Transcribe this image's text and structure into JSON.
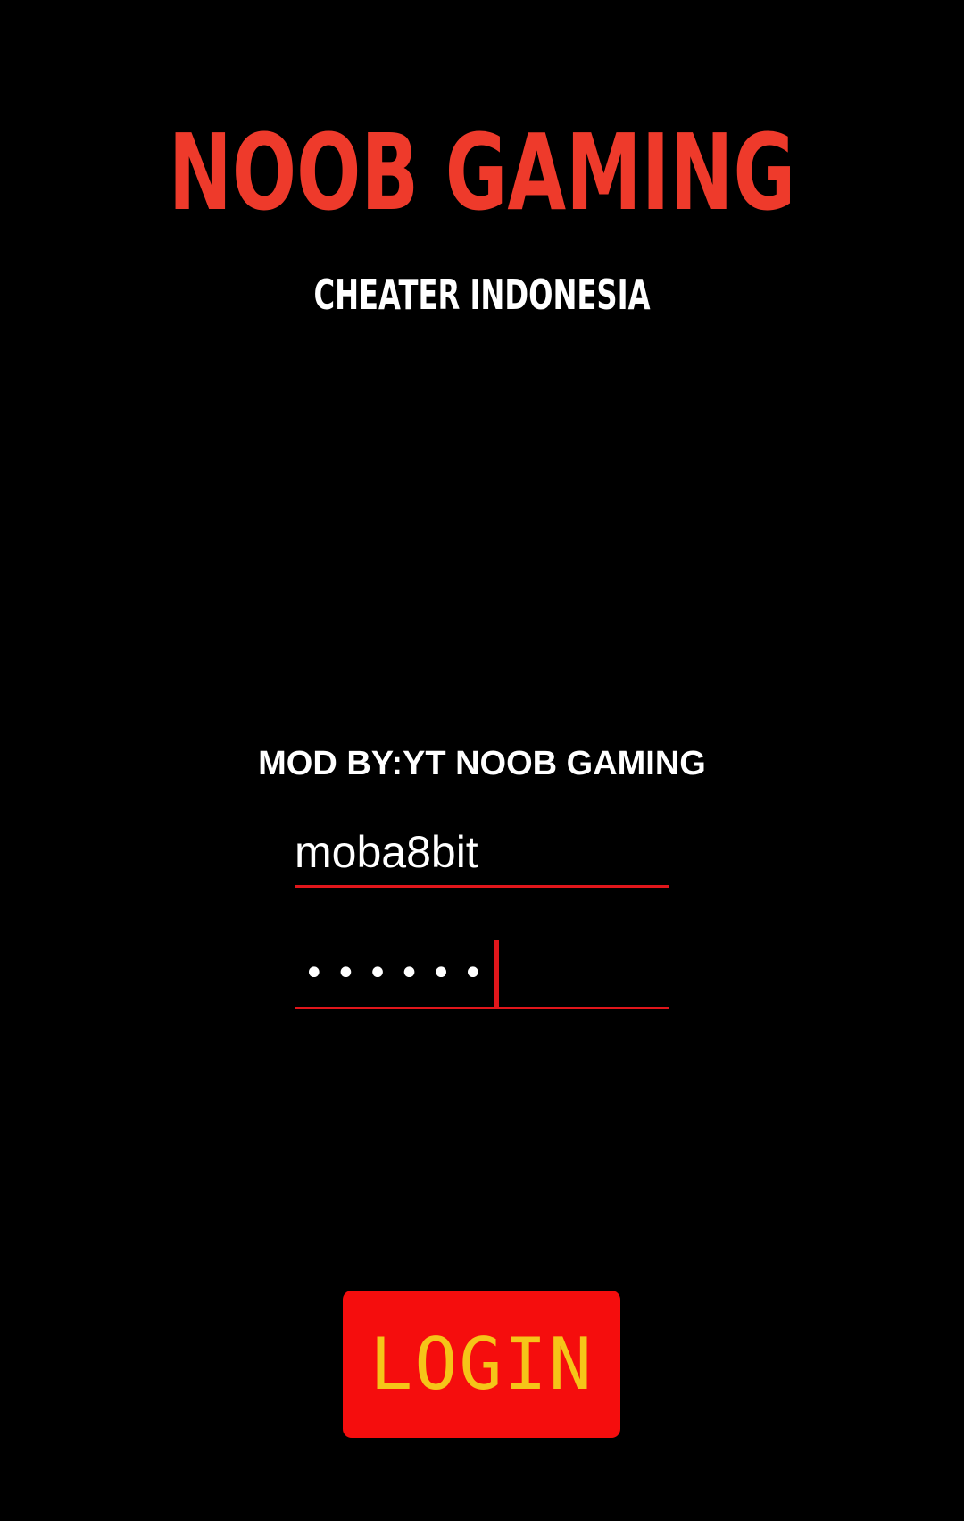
{
  "header": {
    "title": "NOOB GAMING",
    "subtitle": "CHEATER INDONESIA"
  },
  "credit": "MOD BY:YT NOOB GAMING",
  "form": {
    "username_value": "moba8bit",
    "password_mask": "••••••",
    "login_label": "LOGIN"
  },
  "colors": {
    "background": "#000000",
    "title": "#ee3a2b",
    "accent": "#e0161b",
    "button": "#f50d0d",
    "button_text": "#f5c518"
  }
}
